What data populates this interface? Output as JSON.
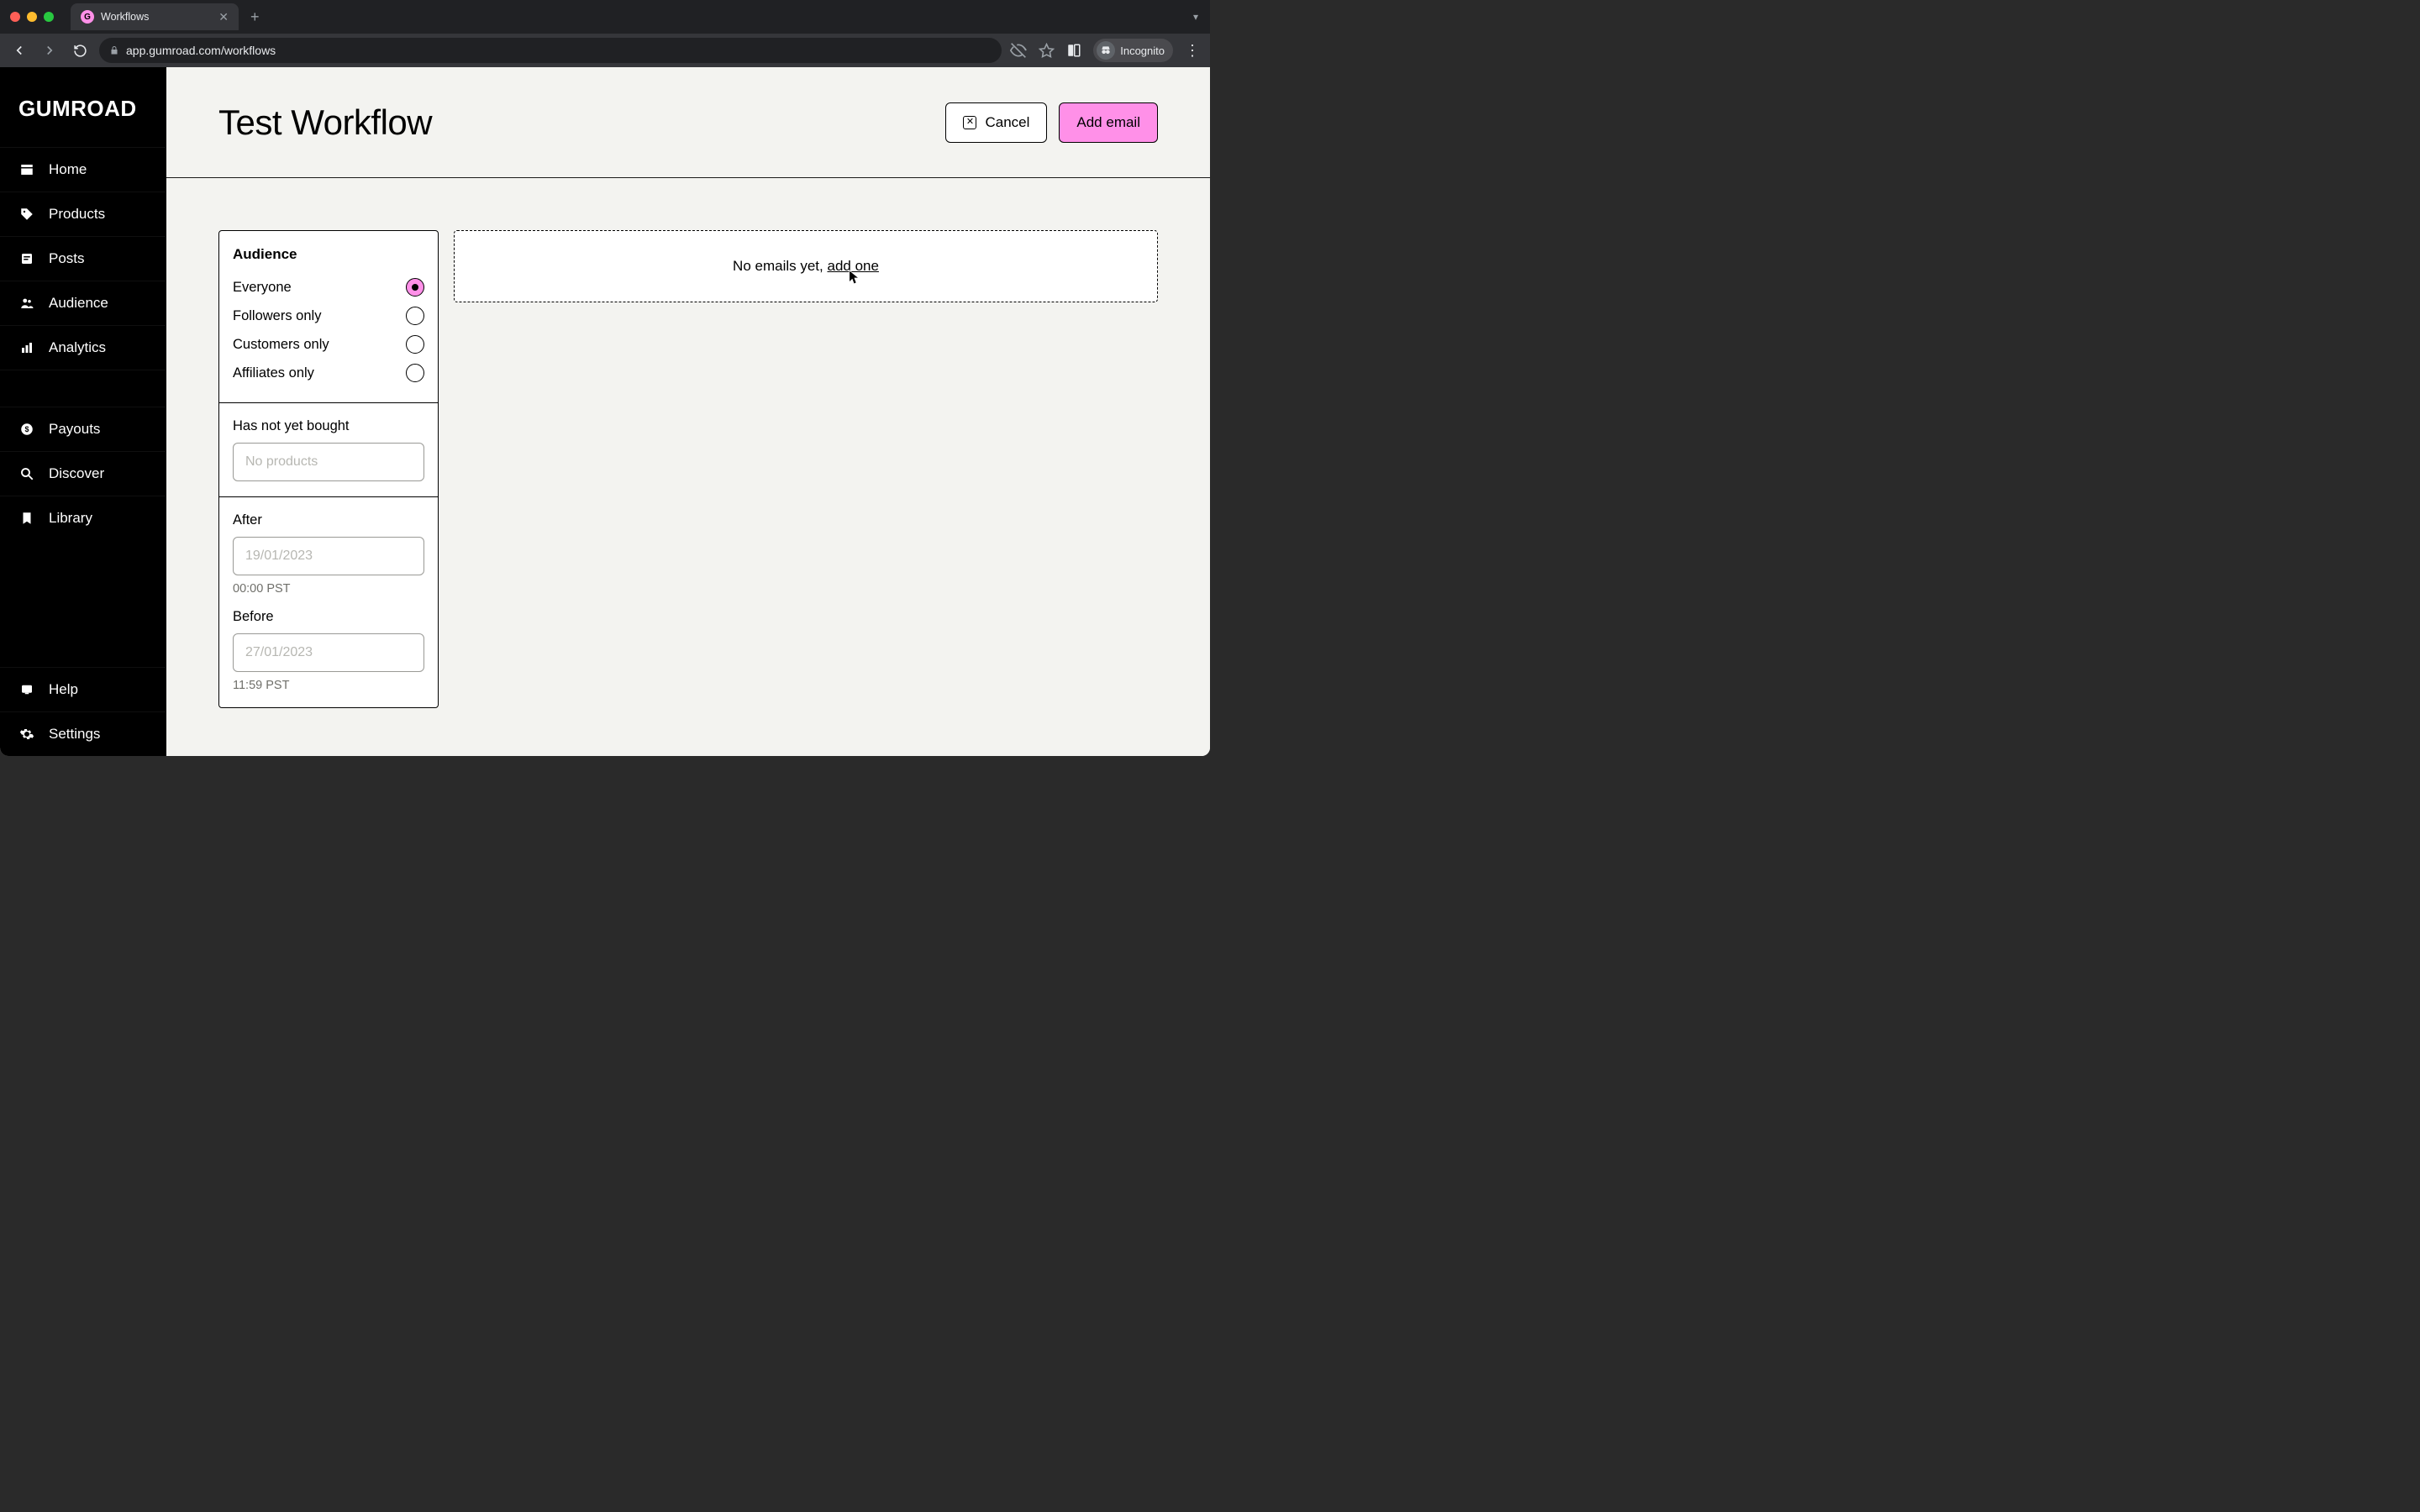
{
  "browser": {
    "tab_title": "Workflows",
    "url": "app.gumroad.com/workflows",
    "incognito_label": "Incognito"
  },
  "brand": {
    "name": "GUMROAD"
  },
  "sidebar": {
    "items": [
      {
        "label": "Home"
      },
      {
        "label": "Products"
      },
      {
        "label": "Posts"
      },
      {
        "label": "Audience"
      },
      {
        "label": "Analytics"
      }
    ],
    "secondary": [
      {
        "label": "Payouts"
      },
      {
        "label": "Discover"
      },
      {
        "label": "Library"
      }
    ],
    "footer": [
      {
        "label": "Help"
      },
      {
        "label": "Settings"
      }
    ]
  },
  "header": {
    "title": "Test Workflow",
    "cancel_label": "Cancel",
    "add_email_label": "Add email"
  },
  "audience": {
    "heading": "Audience",
    "options": [
      {
        "label": "Everyone",
        "selected": true
      },
      {
        "label": "Followers only",
        "selected": false
      },
      {
        "label": "Customers only",
        "selected": false
      },
      {
        "label": "Affiliates only",
        "selected": false
      }
    ]
  },
  "not_bought": {
    "label": "Has not yet bought",
    "placeholder": "No products"
  },
  "date_range": {
    "after_label": "After",
    "after_value": "19/01/2023",
    "after_hint": "00:00 PST",
    "before_label": "Before",
    "before_value": "27/01/2023",
    "before_hint": "11:59 PST"
  },
  "empty_state": {
    "prefix": "No emails yet, ",
    "link": "add one"
  }
}
